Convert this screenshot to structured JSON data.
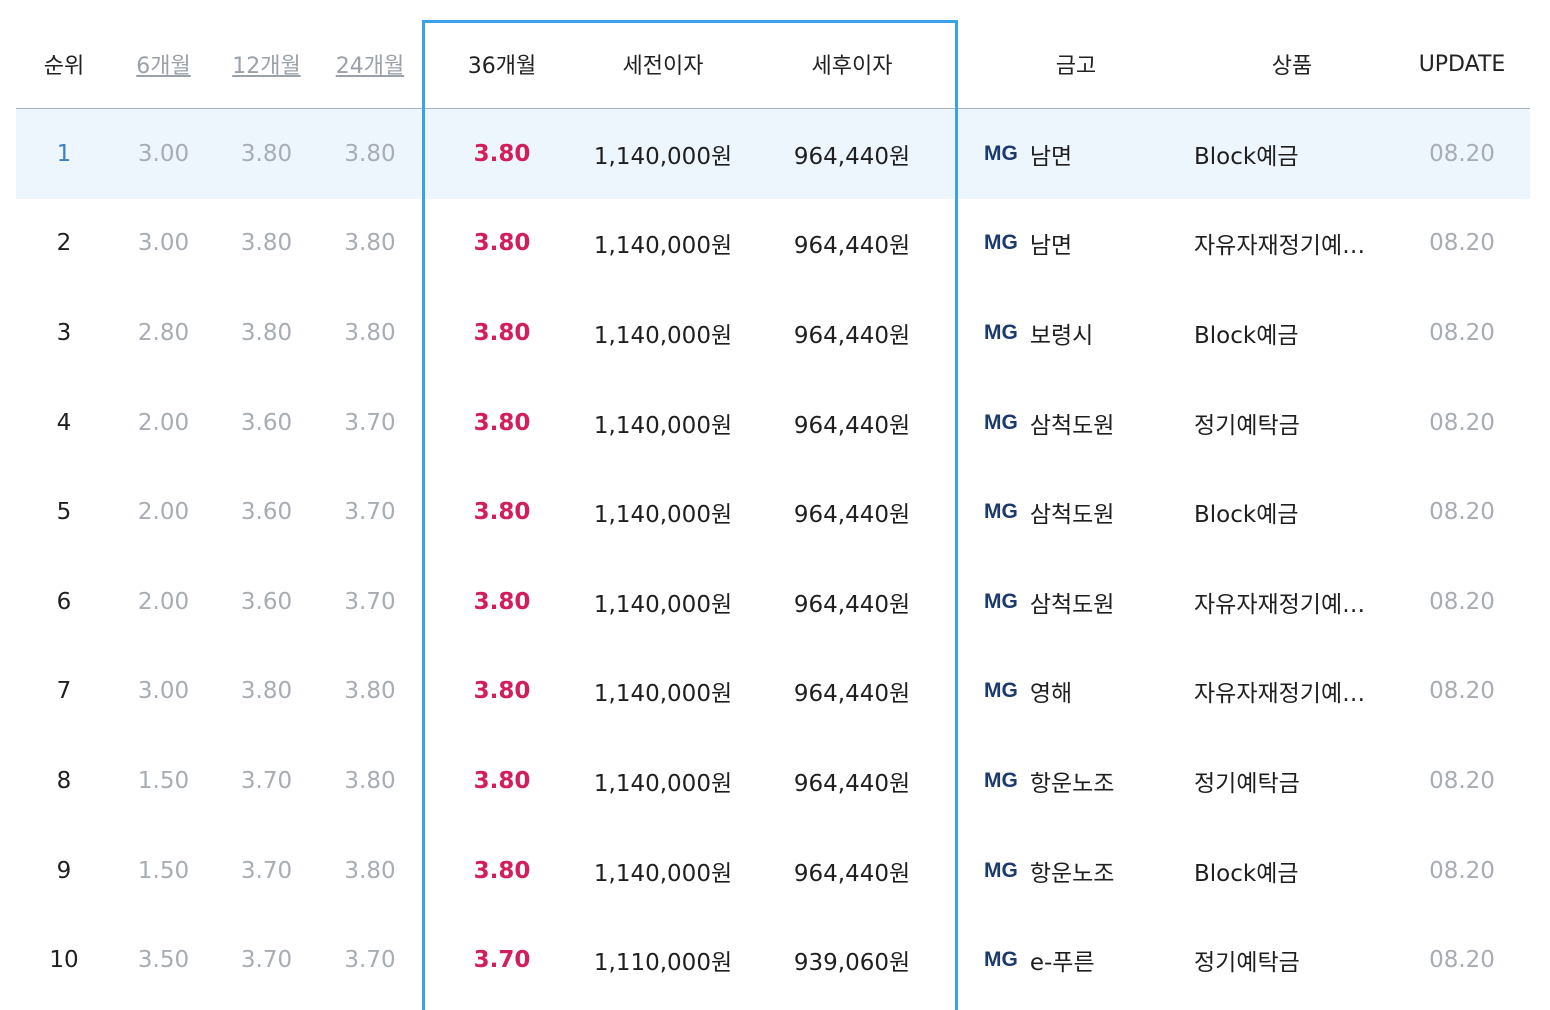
{
  "headers": {
    "rank": "순위",
    "m6": "6개월",
    "m12": "12개월",
    "m24": "24개월",
    "m36": "36개월",
    "pretax": "세전이자",
    "posttax": "세후이자",
    "bank": "금고",
    "product": "상품",
    "update": "UPDATE"
  },
  "bank_prefix": "MG",
  "colors": {
    "highlight_box": "#3aa2e6",
    "rate": "#d21f5b",
    "row_highlight": "#eef6fd",
    "mg_text": "#1c3a6e"
  },
  "rows": [
    {
      "rank": "1",
      "m6": "3.00",
      "m12": "3.80",
      "m24": "3.80",
      "m36": "3.80",
      "pretax": "1,140,000원",
      "posttax": "964,440원",
      "bank": "남면",
      "product": "Block예금",
      "update": "08.20"
    },
    {
      "rank": "2",
      "m6": "3.00",
      "m12": "3.80",
      "m24": "3.80",
      "m36": "3.80",
      "pretax": "1,140,000원",
      "posttax": "964,440원",
      "bank": "남면",
      "product": "자유자재정기예…",
      "update": "08.20"
    },
    {
      "rank": "3",
      "m6": "2.80",
      "m12": "3.80",
      "m24": "3.80",
      "m36": "3.80",
      "pretax": "1,140,000원",
      "posttax": "964,440원",
      "bank": "보령시",
      "product": "Block예금",
      "update": "08.20"
    },
    {
      "rank": "4",
      "m6": "2.00",
      "m12": "3.60",
      "m24": "3.70",
      "m36": "3.80",
      "pretax": "1,140,000원",
      "posttax": "964,440원",
      "bank": "삼척도원",
      "product": "정기예탁금",
      "update": "08.20"
    },
    {
      "rank": "5",
      "m6": "2.00",
      "m12": "3.60",
      "m24": "3.70",
      "m36": "3.80",
      "pretax": "1,140,000원",
      "posttax": "964,440원",
      "bank": "삼척도원",
      "product": "Block예금",
      "update": "08.20"
    },
    {
      "rank": "6",
      "m6": "2.00",
      "m12": "3.60",
      "m24": "3.70",
      "m36": "3.80",
      "pretax": "1,140,000원",
      "posttax": "964,440원",
      "bank": "삼척도원",
      "product": "자유자재정기예…",
      "update": "08.20"
    },
    {
      "rank": "7",
      "m6": "3.00",
      "m12": "3.80",
      "m24": "3.80",
      "m36": "3.80",
      "pretax": "1,140,000원",
      "posttax": "964,440원",
      "bank": "영해",
      "product": "자유자재정기예…",
      "update": "08.20"
    },
    {
      "rank": "8",
      "m6": "1.50",
      "m12": "3.70",
      "m24": "3.80",
      "m36": "3.80",
      "pretax": "1,140,000원",
      "posttax": "964,440원",
      "bank": "항운노조",
      "product": "정기예탁금",
      "update": "08.20"
    },
    {
      "rank": "9",
      "m6": "1.50",
      "m12": "3.70",
      "m24": "3.80",
      "m36": "3.80",
      "pretax": "1,140,000원",
      "posttax": "964,440원",
      "bank": "항운노조",
      "product": "Block예금",
      "update": "08.20"
    },
    {
      "rank": "10",
      "m6": "3.50",
      "m12": "3.70",
      "m24": "3.70",
      "m36": "3.70",
      "pretax": "1,110,000원",
      "posttax": "939,060원",
      "bank": "e-푸른",
      "product": "정기예탁금",
      "update": "08.20"
    }
  ]
}
